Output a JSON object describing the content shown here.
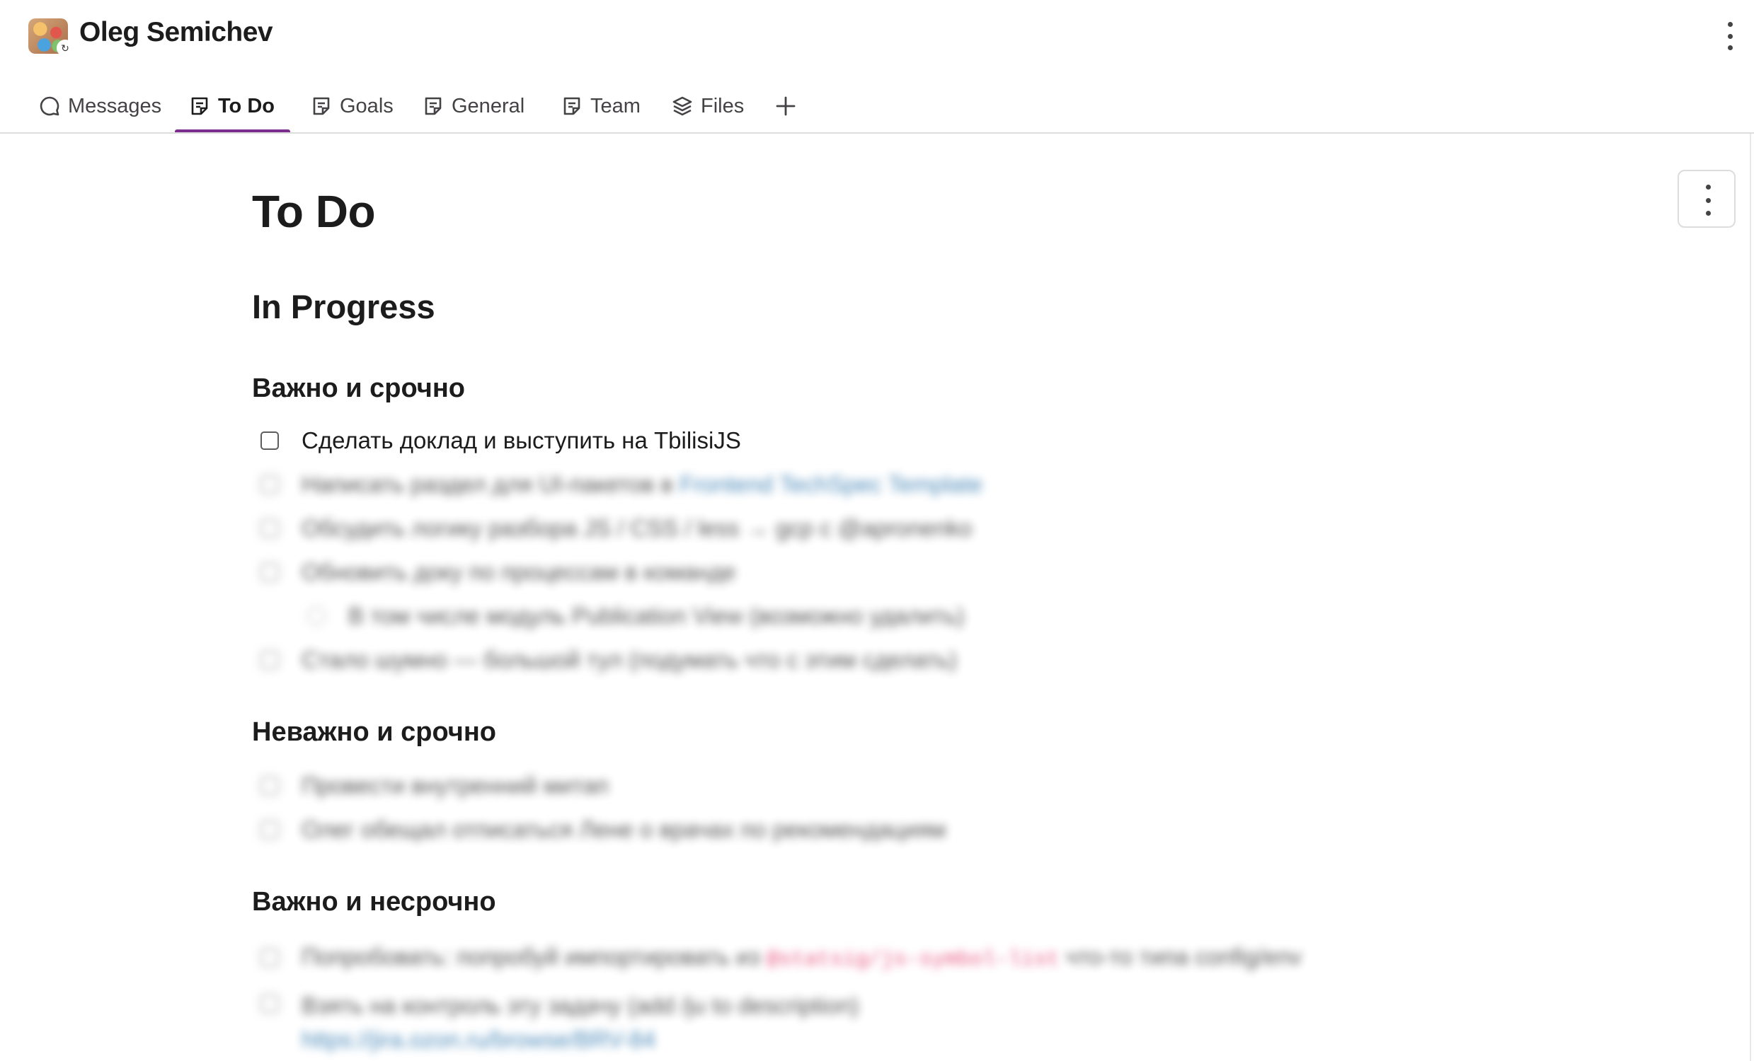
{
  "header": {
    "title": "Oleg Semichev"
  },
  "tabs": [
    {
      "label": "Messages",
      "icon": "chat-bubble-icon"
    },
    {
      "label": "To Do",
      "icon": "canvas-icon",
      "active": true
    },
    {
      "label": "Goals",
      "icon": "canvas-icon"
    },
    {
      "label": "General",
      "icon": "canvas-icon"
    },
    {
      "label": "Team",
      "icon": "canvas-icon"
    },
    {
      "label": "Files",
      "icon": "layers-icon"
    }
  ],
  "doc": {
    "title": "To Do",
    "heading": "In Progress",
    "sections": [
      {
        "title": "Важно и срочно",
        "tasks": [
          {
            "text": "Сделать доклад и выступить на TbilisiJS"
          },
          {
            "text": "Написать раздел для UI-пакетов в",
            "link": "Frontend TechSpec Template"
          },
          {
            "text": "Обсудить логику разбора JS / CSS / less → gcp с @apronenko"
          },
          {
            "text": "Обновить доку по процессам в команде"
          },
          {
            "text": "В том числе модуль Publication View (возможно удалить)"
          },
          {
            "text": "Стало шумно — большой тул (подумать что с этим сделать)"
          }
        ]
      },
      {
        "title": "Неважно и срочно",
        "tasks": [
          {
            "text": "Провести внутренний митап"
          },
          {
            "text": "Олег обещал отписаться Лене о врачах по рекомендациям"
          }
        ]
      },
      {
        "title": "Важно и несрочно",
        "tasks": [
          {
            "text": "Попробовать: попробуй импортировать из",
            "code": "@statsig/js-symbol-list",
            "suffix": "что-то типа config/env"
          },
          {
            "text": "Взять на контроль эту задачу (add /ju to description)",
            "link": "https://jira.ozon.ru/browse/BRV-84"
          }
        ]
      }
    ]
  }
}
